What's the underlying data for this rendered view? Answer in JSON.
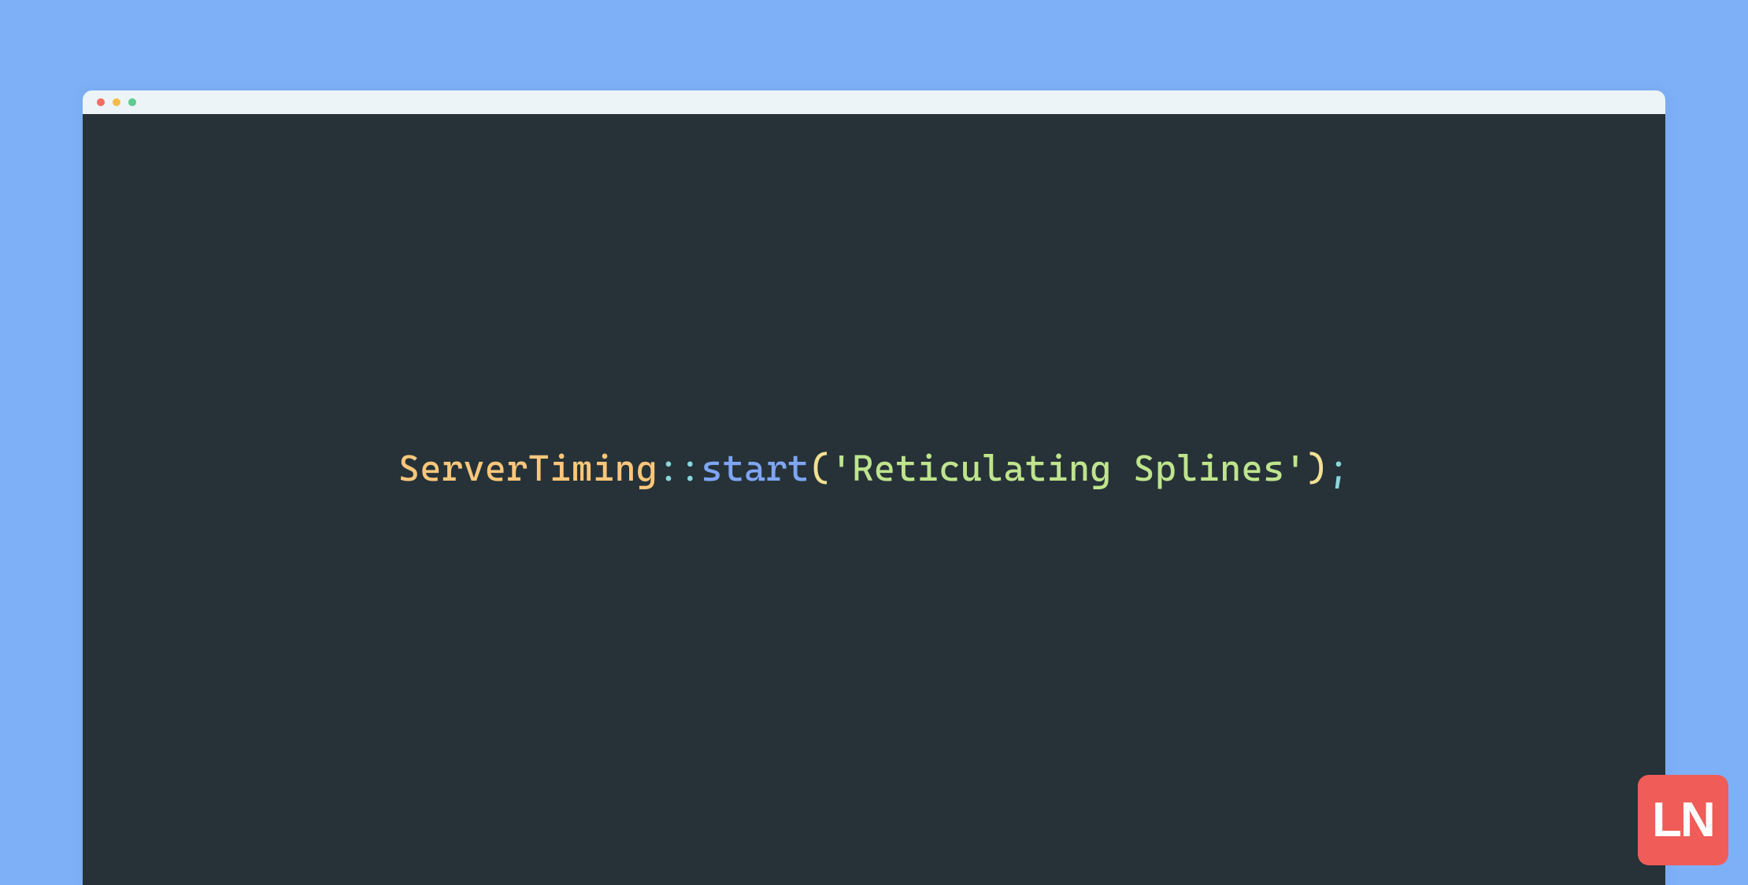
{
  "colors": {
    "page_bg": "#7eb0f7",
    "titlebar_bg": "#ecf4f7",
    "editor_bg": "#263238",
    "dot_red": "#f26d63",
    "dot_yellow": "#f5bb4a",
    "dot_green": "#5ecb8f",
    "watermark_bg": "#f05c58",
    "token_class": "#fec77c",
    "token_punct": "#8bd6dc",
    "token_method": "#7fa5f3",
    "token_paren": "#f2e094",
    "token_string": "#bfe48d"
  },
  "code": {
    "class_name": "ServerTiming",
    "scope_operator": "::",
    "method_name": "start",
    "open_paren": "(",
    "string_literal": "'Reticulating Splines'",
    "close_paren": ")",
    "terminator": ";"
  },
  "watermark": {
    "text": "LN"
  }
}
